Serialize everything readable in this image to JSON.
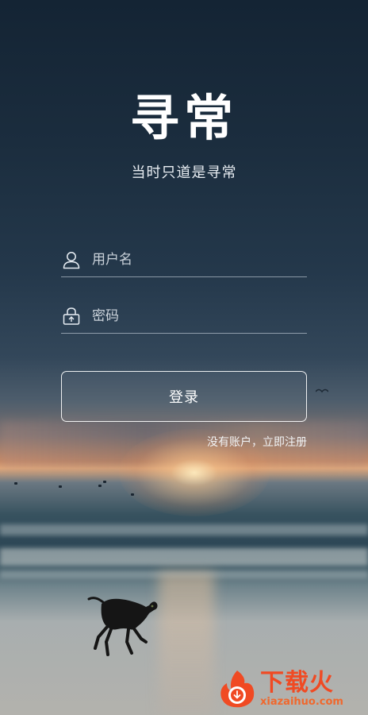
{
  "app": {
    "title": "寻常",
    "slogan": "当时只道是寻常"
  },
  "form": {
    "username_placeholder": "用户名",
    "password_placeholder": "密码",
    "login_label": "登录",
    "register_link": "没有账户，立即注册"
  },
  "watermark": {
    "main_text": "下载火",
    "sub_text": "xiazaihuo.com"
  },
  "icons": {
    "username": "user-icon",
    "password": "lock-icon"
  },
  "colors": {
    "watermark": "#f04a23",
    "input_underline": "rgba(220,230,240,0.55)",
    "button_border": "#ffffff"
  }
}
